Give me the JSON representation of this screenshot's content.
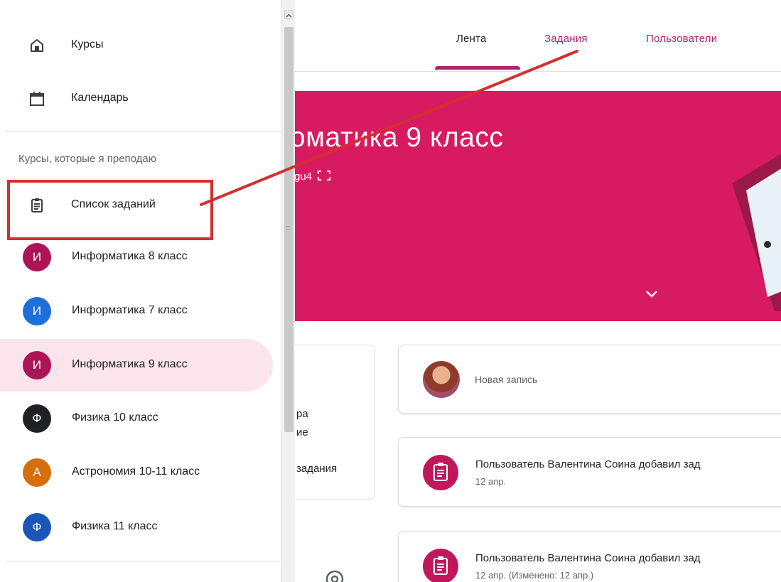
{
  "tabs": [
    {
      "label": "Лента",
      "active": true
    },
    {
      "label": "Задания",
      "active": false
    },
    {
      "label": "Пользователи",
      "active": false
    }
  ],
  "banner": {
    "title": "оматика 9 класс",
    "code": "gu4",
    "color": "#d81b60"
  },
  "side_card": {
    "line1": "ра",
    "line2": "ие",
    "line3": "задания"
  },
  "new_post": {
    "placeholder": "Новая запись"
  },
  "posts": [
    {
      "title": "Пользователь Валентина Соина добавил зад",
      "date": "12 апр."
    },
    {
      "title": "Пользователь Валентина Соина добавил зад",
      "date": "12 апр. (Изменено: 12 апр.)"
    }
  ],
  "drawer": {
    "top_items": [
      {
        "label": "Курсы",
        "icon": "home-icon"
      },
      {
        "label": "Календарь",
        "icon": "calendar-icon"
      }
    ],
    "section_heading": "Курсы, которые я преподаю",
    "todo_item": {
      "label": "Список заданий",
      "icon": "assignment-list-icon"
    },
    "courses": [
      {
        "letter": "И",
        "label": "Информатика 8 класс",
        "color": "#ad1457",
        "selected": false
      },
      {
        "letter": "И",
        "label": "Информатика 7 класс",
        "color": "#1e6fd9",
        "selected": false
      },
      {
        "letter": "И",
        "label": "Информатика 9 класс",
        "color": "#ad1457",
        "selected": true
      },
      {
        "letter": "Ф",
        "label": "Физика 10 класс",
        "color": "#202124",
        "selected": false
      },
      {
        "letter": "А",
        "label": "Астрономия 10-11 класс",
        "color": "#d56e0c",
        "selected": false
      },
      {
        "letter": "Ф",
        "label": "Физика 11 класс",
        "color": "#1a56b8",
        "selected": false
      }
    ]
  },
  "accent_colors": {
    "brand": "#b0246e",
    "annotation": "#d32f2f"
  }
}
